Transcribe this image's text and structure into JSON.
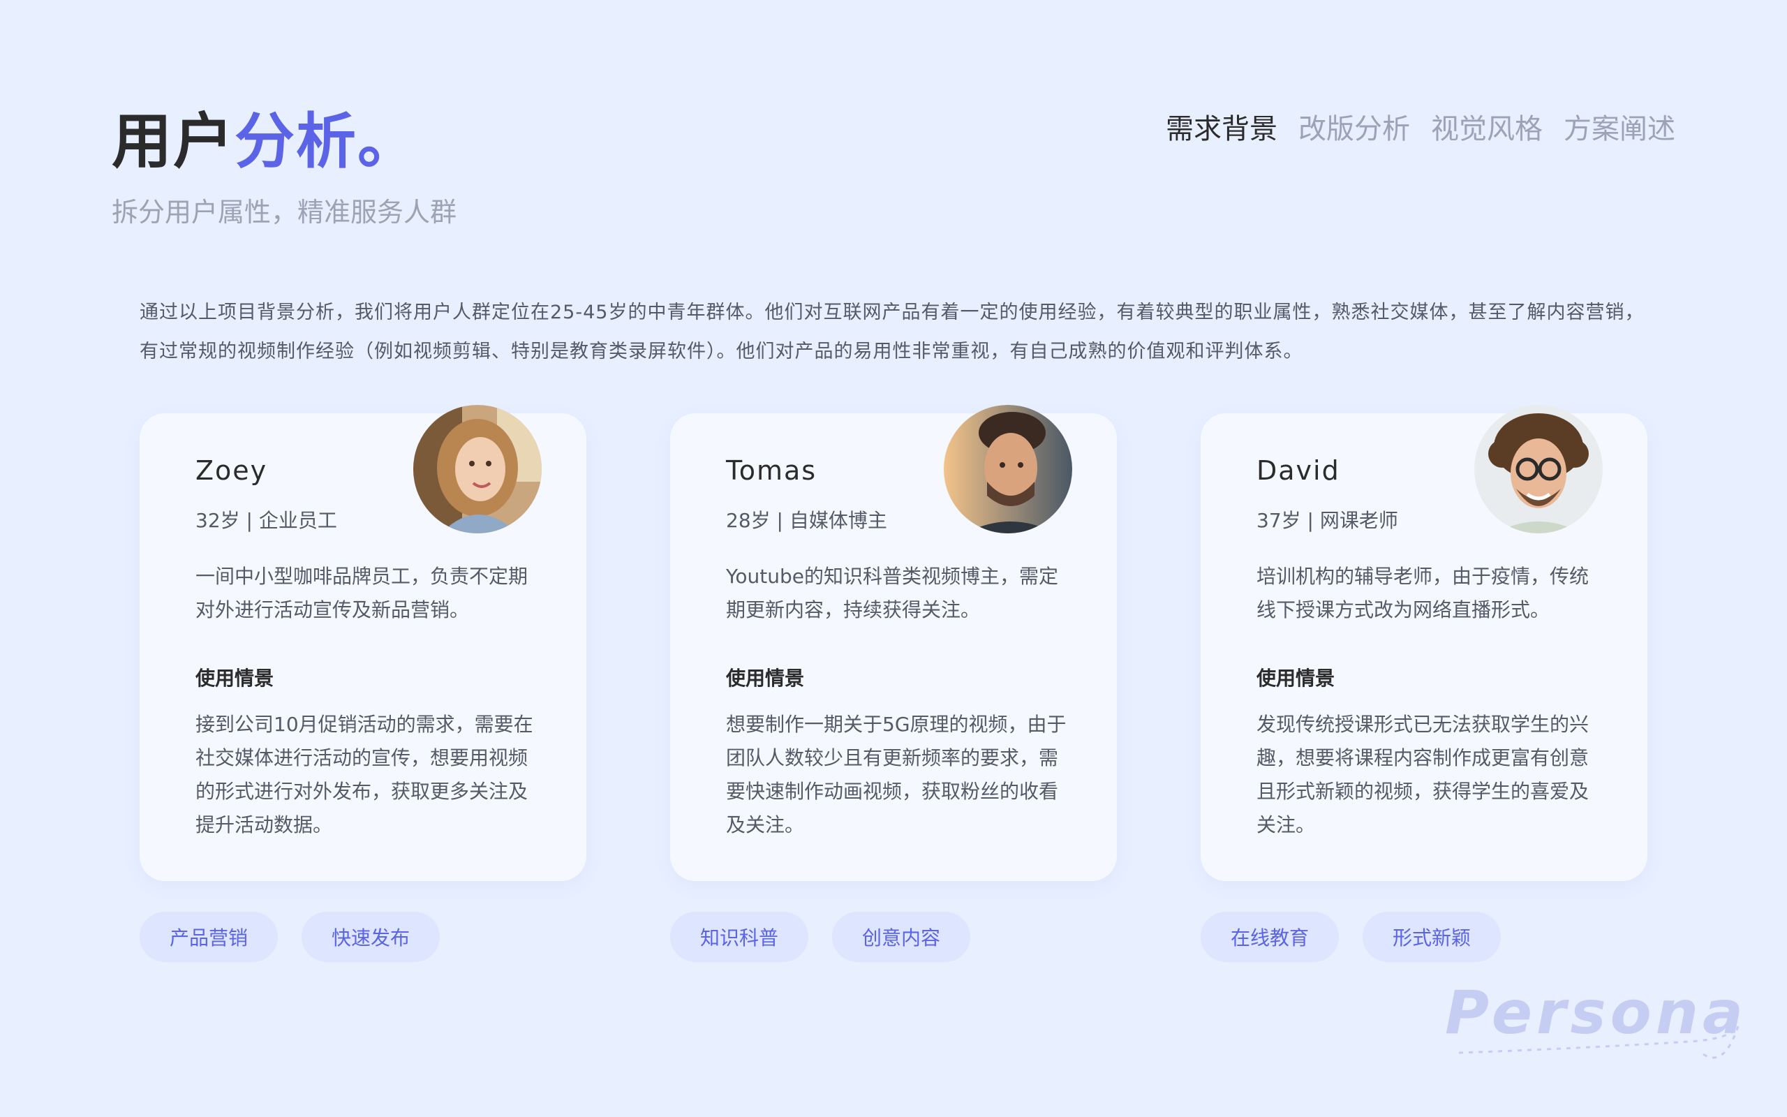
{
  "header": {
    "title_part1": "用户",
    "title_part2": "分析。",
    "subtitle": "拆分用户属性，精准服务人群"
  },
  "nav": {
    "tabs": [
      "需求背景",
      "改版分析",
      "视觉风格",
      "方案阐述"
    ],
    "active_index": 0
  },
  "intro": "通过以上项目背景分析，我们将用户人群定位在25-45岁的中青年群体。他们对互联网产品有着一定的使用经验，有着较典型的职业属性，熟悉社交媒体，甚至了解内容营销，有过常规的视频制作经验（例如视频剪辑、特别是教育类录屏软件）。他们对产品的易用性非常重视，有自己成熟的价值观和评判体系。",
  "personas": [
    {
      "name": "Zoey",
      "meta": "32岁 | 企业员工",
      "desc": "一间中小型咖啡品牌员工，负责不定期对外进行活动宣传及新品营销。",
      "scene_title": "使用情景",
      "scene_text": "接到公司10月促销活动的需求，需要在社交媒体进行活动的宣传，想要用视频的形式进行对外发布，获取更多关注及提升活动数据。",
      "tags": [
        "产品营销",
        "快速发布"
      ]
    },
    {
      "name": "Tomas",
      "meta": "28岁 | 自媒体博主",
      "desc": "Youtube的知识科普类视频博主，需定期更新内容，持续获得关注。",
      "scene_title": "使用情景",
      "scene_text": "想要制作一期关于5G原理的视频，由于团队人数较少且有更新频率的要求，需要快速制作动画视频，获取粉丝的收看及关注。",
      "tags": [
        "知识科普",
        "创意内容"
      ]
    },
    {
      "name": "David",
      "meta": "37岁 | 网课老师",
      "desc": "培训机构的辅导老师，由于疫情，传统线下授课方式改为网络直播形式。",
      "scene_title": "使用情景",
      "scene_text": "发现传统授课形式已无法获取学生的兴趣，想要将课程内容制作成更富有创意且形式新颖的视频，获得学生的喜爱及关注。",
      "tags": [
        "在线教育",
        "形式新颖"
      ]
    }
  ],
  "watermark": "Persona",
  "colors": {
    "accent": "#5b63e6",
    "background": "#e8efff",
    "card": "#f5f8ff",
    "tag_bg": "#dde5ff"
  }
}
